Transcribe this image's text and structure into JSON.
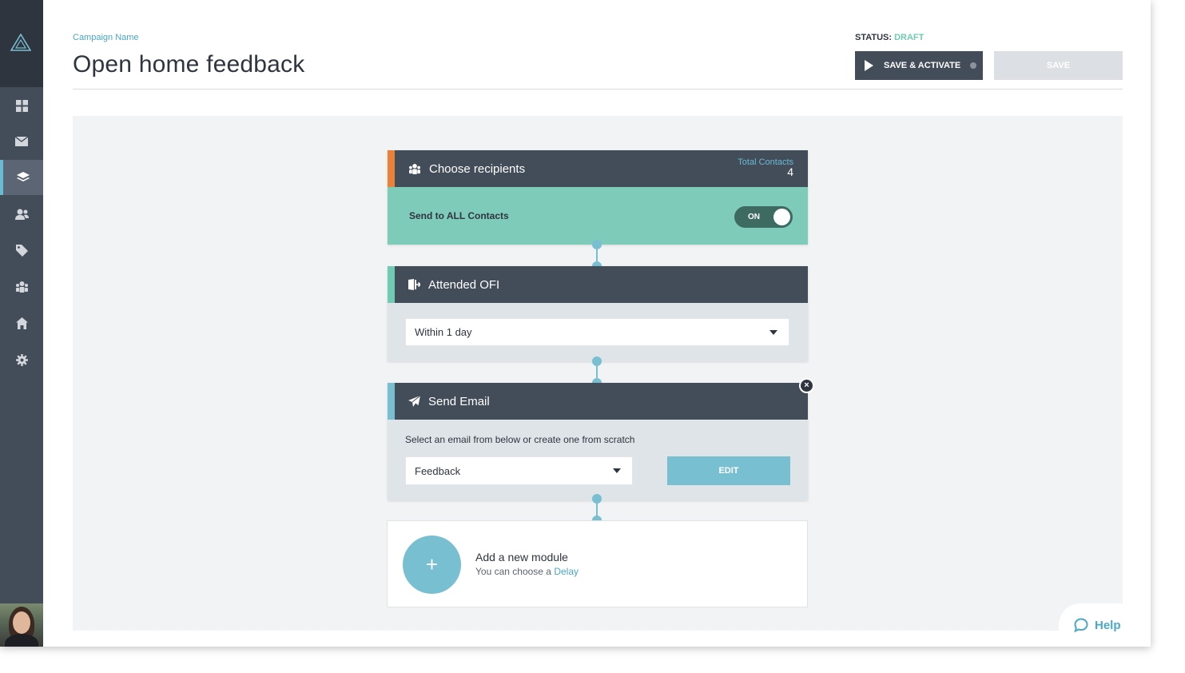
{
  "header": {
    "campaign_label": "Campaign Name",
    "title": "Open home feedback",
    "status_label": "STATUS: ",
    "status_value": "DRAFT",
    "save_activate_label": "SAVE & ACTIVATE",
    "save_label": "SAVE"
  },
  "sidebar": {
    "items": [
      {
        "icon": "dashboard-icon"
      },
      {
        "icon": "envelope-icon"
      },
      {
        "icon": "layers-icon",
        "active": true
      },
      {
        "icon": "contacts-icon"
      },
      {
        "icon": "tag-icon"
      },
      {
        "icon": "groups-icon"
      },
      {
        "icon": "home-icon"
      },
      {
        "icon": "gear-icon"
      }
    ]
  },
  "modules": {
    "recipients": {
      "title": "Choose recipients",
      "total_label": "Total Contacts",
      "total_value": "4",
      "send_all_label": "Send to ALL Contacts",
      "toggle_label": "ON",
      "accent": "#e8823a"
    },
    "attended": {
      "title": "Attended OFI",
      "select_value": "Within 1 day",
      "accent": "#6fcbb1"
    },
    "send_email": {
      "title": "Send Email",
      "hint": "Select an email from below or create one from scratch",
      "select_value": "Feedback",
      "edit_label": "EDIT",
      "close_label": "×",
      "accent": "#78bfd2"
    },
    "add_module": {
      "plus": "+",
      "title": "Add a new module",
      "subtitle": "You can choose a ",
      "link": "Delay"
    }
  },
  "help": {
    "label": "Help"
  },
  "colors": {
    "sidebar": "#434c59",
    "accent_blue": "#78bfd2",
    "teal": "#7fcbb9",
    "draft": "#6fcbb1"
  }
}
